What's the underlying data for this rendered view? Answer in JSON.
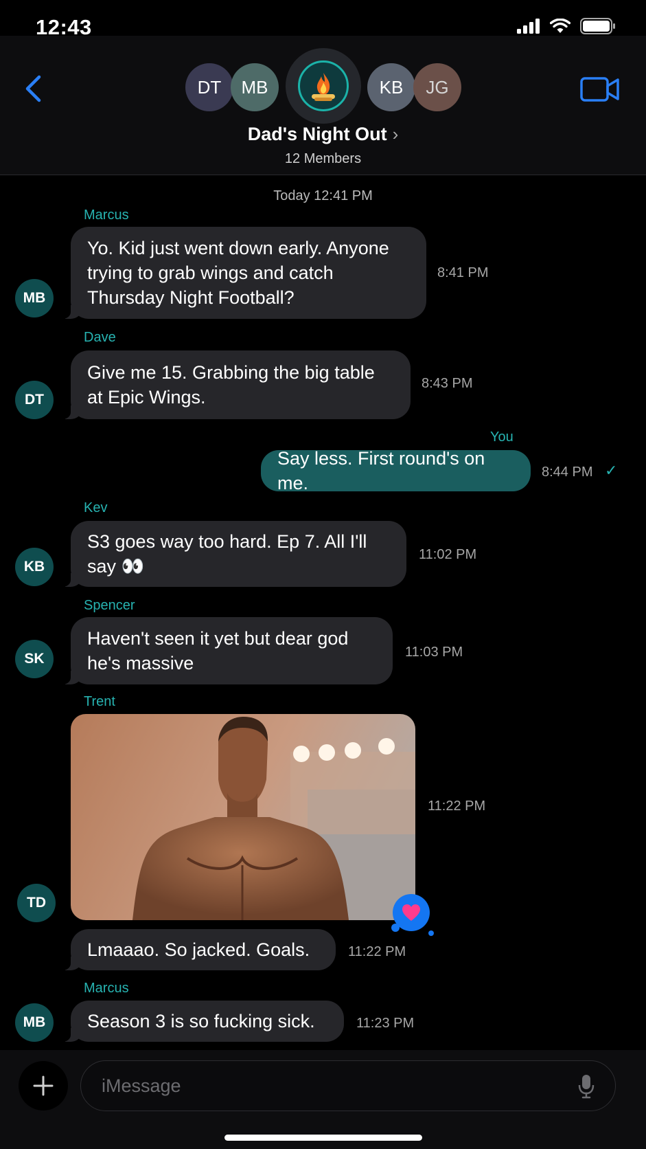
{
  "status_bar": {
    "time": "12:43"
  },
  "header": {
    "group_name": "Dad's Night Out",
    "members": "12 Members",
    "avatars": [
      {
        "initials": "DT",
        "color": "#3a3a52"
      },
      {
        "initials": "MB",
        "color": "#4e6b68"
      },
      {
        "initials": "KB",
        "color": "#5b6370"
      },
      {
        "initials": "JG",
        "color": "#6b5049"
      }
    ]
  },
  "conversation": {
    "timestamp": "Today 12:41 PM",
    "messages": [
      {
        "sender": "Marcus",
        "initials": "MB",
        "text": "Yo. Kid just went down early. Anyone trying to grab wings and catch Thursday Night Football?",
        "time": "8:41 PM"
      },
      {
        "sender": "Dave",
        "initials": "DT",
        "text": "Give me 15. Grabbing the big table at Epic Wings.",
        "time": "8:43 PM"
      },
      {
        "sender": "You",
        "text": "Say less. First round's on me.",
        "time": "8:44 PM",
        "status": "✓"
      },
      {
        "sender": "Kev",
        "initials": "KB",
        "text": "S3 goes way too hard. Ep 7. All I'll say",
        "emoji": "👀",
        "time": "11:02 PM"
      },
      {
        "sender": "Spencer",
        "initials": "SK",
        "text": "Haven't seen it yet but dear god he's massive",
        "time": "11:03 PM"
      },
      {
        "sender": "Trent",
        "initials": "TD",
        "photo_time": "11:22 PM",
        "reaction": "heart",
        "text": "Lmaaao. So jacked. Goals.",
        "time": "11:22 PM"
      },
      {
        "sender": "Marcus",
        "initials": "MB",
        "text": "Season 3 is so fucking sick.",
        "time": "11:23 PM"
      }
    ]
  },
  "input": {
    "placeholder": "iMessage"
  },
  "colors": {
    "accent": "#2a7ff6",
    "sender_name": "#27b3b1",
    "outgoing_bubble": "#1a5e5f",
    "incoming_bubble": "#26262a"
  }
}
